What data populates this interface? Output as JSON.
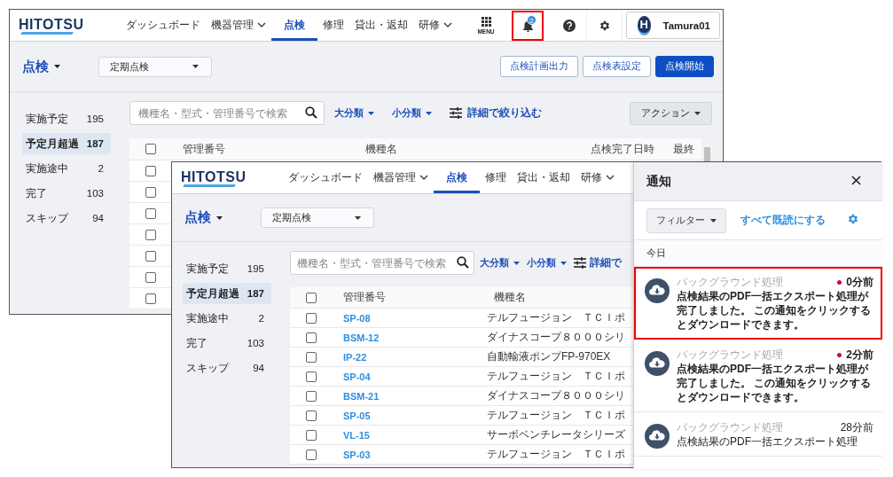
{
  "back_window": {
    "header": {
      "logo": "HITOTSU",
      "nav": [
        {
          "label": "ダッシュボード",
          "dropdown": false,
          "selected": false
        },
        {
          "label": "機器管理",
          "dropdown": true,
          "selected": false
        },
        {
          "label": "点検",
          "dropdown": false,
          "selected": true
        },
        {
          "label": "修理",
          "dropdown": false,
          "selected": false
        },
        {
          "label": "貸出・返却",
          "dropdown": false,
          "selected": false
        },
        {
          "label": "研修",
          "dropdown": true,
          "selected": false
        }
      ],
      "menu_label": "MENU",
      "notification_count": "2",
      "bell_highlighted": true,
      "user": {
        "initial": "H",
        "name": "Tamura01"
      }
    },
    "page": {
      "title": "点検",
      "type_select": "定期点検",
      "buttons": [
        {
          "label": "点検計画出力",
          "kind": "outline"
        },
        {
          "label": "点検表設定",
          "kind": "outline"
        },
        {
          "label": "点検開始",
          "kind": "primary"
        }
      ]
    },
    "status_list": [
      {
        "label": "実施予定",
        "count": "195",
        "selected": false
      },
      {
        "label": "予定月超過",
        "count": "187",
        "selected": true
      },
      {
        "label": "実施途中",
        "count": "2",
        "selected": false
      },
      {
        "label": "完了",
        "count": "103",
        "selected": false
      },
      {
        "label": "スキップ",
        "count": "94",
        "selected": false
      }
    ],
    "toolbar": {
      "search_placeholder": "機種名・型式・管理番号で検索",
      "filters": [
        "大分類",
        "小分類"
      ],
      "detail_filter": "詳細で絞り込む",
      "action_button": "アクション"
    },
    "table": {
      "header_checked": false,
      "columns": [
        "管理番号",
        "機種名",
        "点検完了日時",
        "最終"
      ],
      "rows": [
        {
          "checked": false
        },
        {
          "checked": false
        },
        {
          "checked": false
        },
        {
          "checked": false
        },
        {
          "checked": false
        },
        {
          "checked": false
        },
        {
          "checked": false
        }
      ]
    }
  },
  "front_window": {
    "header": {
      "logo": "HITOTSU",
      "nav": [
        {
          "label": "ダッシュボード",
          "dropdown": false,
          "selected": false
        },
        {
          "label": "機器管理",
          "dropdown": true,
          "selected": false
        },
        {
          "label": "点検",
          "dropdown": false,
          "selected": true
        },
        {
          "label": "修理",
          "dropdown": false,
          "selected": false
        },
        {
          "label": "貸出・返却",
          "dropdown": false,
          "selected": false
        },
        {
          "label": "研修",
          "dropdown": true,
          "selected": false
        }
      ]
    },
    "page": {
      "title": "点検",
      "type_select": "定期点検"
    },
    "status_list": [
      {
        "label": "実施予定",
        "count": "195",
        "selected": false
      },
      {
        "label": "予定月超過",
        "count": "187",
        "selected": true
      },
      {
        "label": "実施途中",
        "count": "2",
        "selected": false
      },
      {
        "label": "完了",
        "count": "103",
        "selected": false
      },
      {
        "label": "スキップ",
        "count": "94",
        "selected": false
      }
    ],
    "toolbar": {
      "search_placeholder": "機種名・型式・管理番号で検索",
      "filters": [
        "大分類",
        "小分類"
      ],
      "detail_filter": "詳細で"
    },
    "table": {
      "header_checked": false,
      "columns": [
        "管理番号",
        "機種名"
      ],
      "rows": [
        {
          "checked": false,
          "id": "SP-08",
          "name": "テルフュージョン　ＴＣＩポ"
        },
        {
          "checked": false,
          "id": "BSM-12",
          "name": "ダイナスコープ８０００シリ"
        },
        {
          "checked": false,
          "id": "IP-22",
          "name": "自動輸液ポンプFP-970EX"
        },
        {
          "checked": false,
          "id": "SP-04",
          "name": "テルフュージョン　ＴＣＩポ"
        },
        {
          "checked": false,
          "id": "BSM-21",
          "name": "ダイナスコープ８０００シリ"
        },
        {
          "checked": false,
          "id": "SP-05",
          "name": "テルフュージョン　ＴＣＩポ"
        },
        {
          "checked": false,
          "id": "VL-15",
          "name": "サーボベンチレータシリーズ"
        },
        {
          "checked": false,
          "id": "SP-03",
          "name": "テルフュージョン　ＴＣＩポ"
        }
      ]
    }
  },
  "notification_panel": {
    "title": "通知",
    "filter_button": "フィルター",
    "mark_all_read": "すべて既読にする",
    "section": "今日",
    "items": [
      {
        "category": "バックグラウンド処理",
        "message": "点検結果のPDF一括エクスポート処理が完了しました。 この通知をクリックするとダウンロードできます。",
        "time": "0分前",
        "unread": true,
        "highlighted": true
      },
      {
        "category": "バックグラウンド処理",
        "message": "点検結果のPDF一括エクスポート処理が完了しました。 この通知をクリックするとダウンロードできます。",
        "time": "2分前",
        "unread": true,
        "highlighted": false
      },
      {
        "category": "バックグラウンド処理",
        "message": "点検結果のPDF一括エクスポート処理",
        "time": "28分前",
        "unread": false,
        "highlighted": false
      }
    ]
  }
}
